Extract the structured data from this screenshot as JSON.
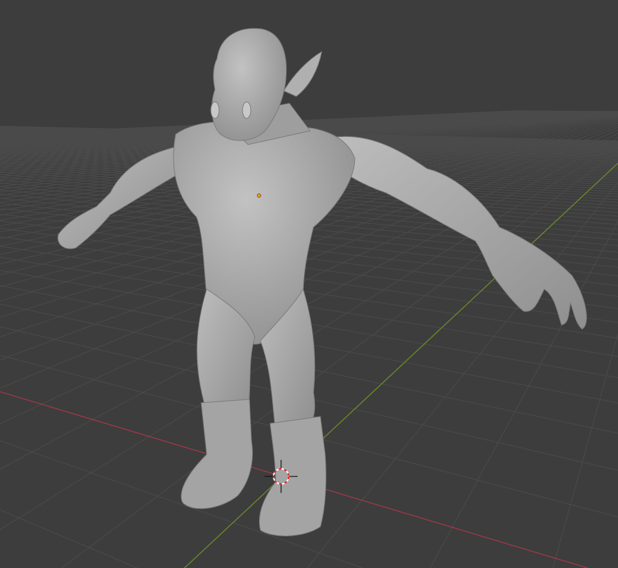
{
  "viewport": {
    "background_color": "#3d3d3d",
    "grid_color": "#4b4b4b",
    "x_axis_color": "#a03a48",
    "y_axis_color": "#6a8f2a",
    "model_color": "#a9a9a9",
    "origin_color": "#ff9a1f",
    "cursor_icon": "3d-cursor-icon"
  }
}
